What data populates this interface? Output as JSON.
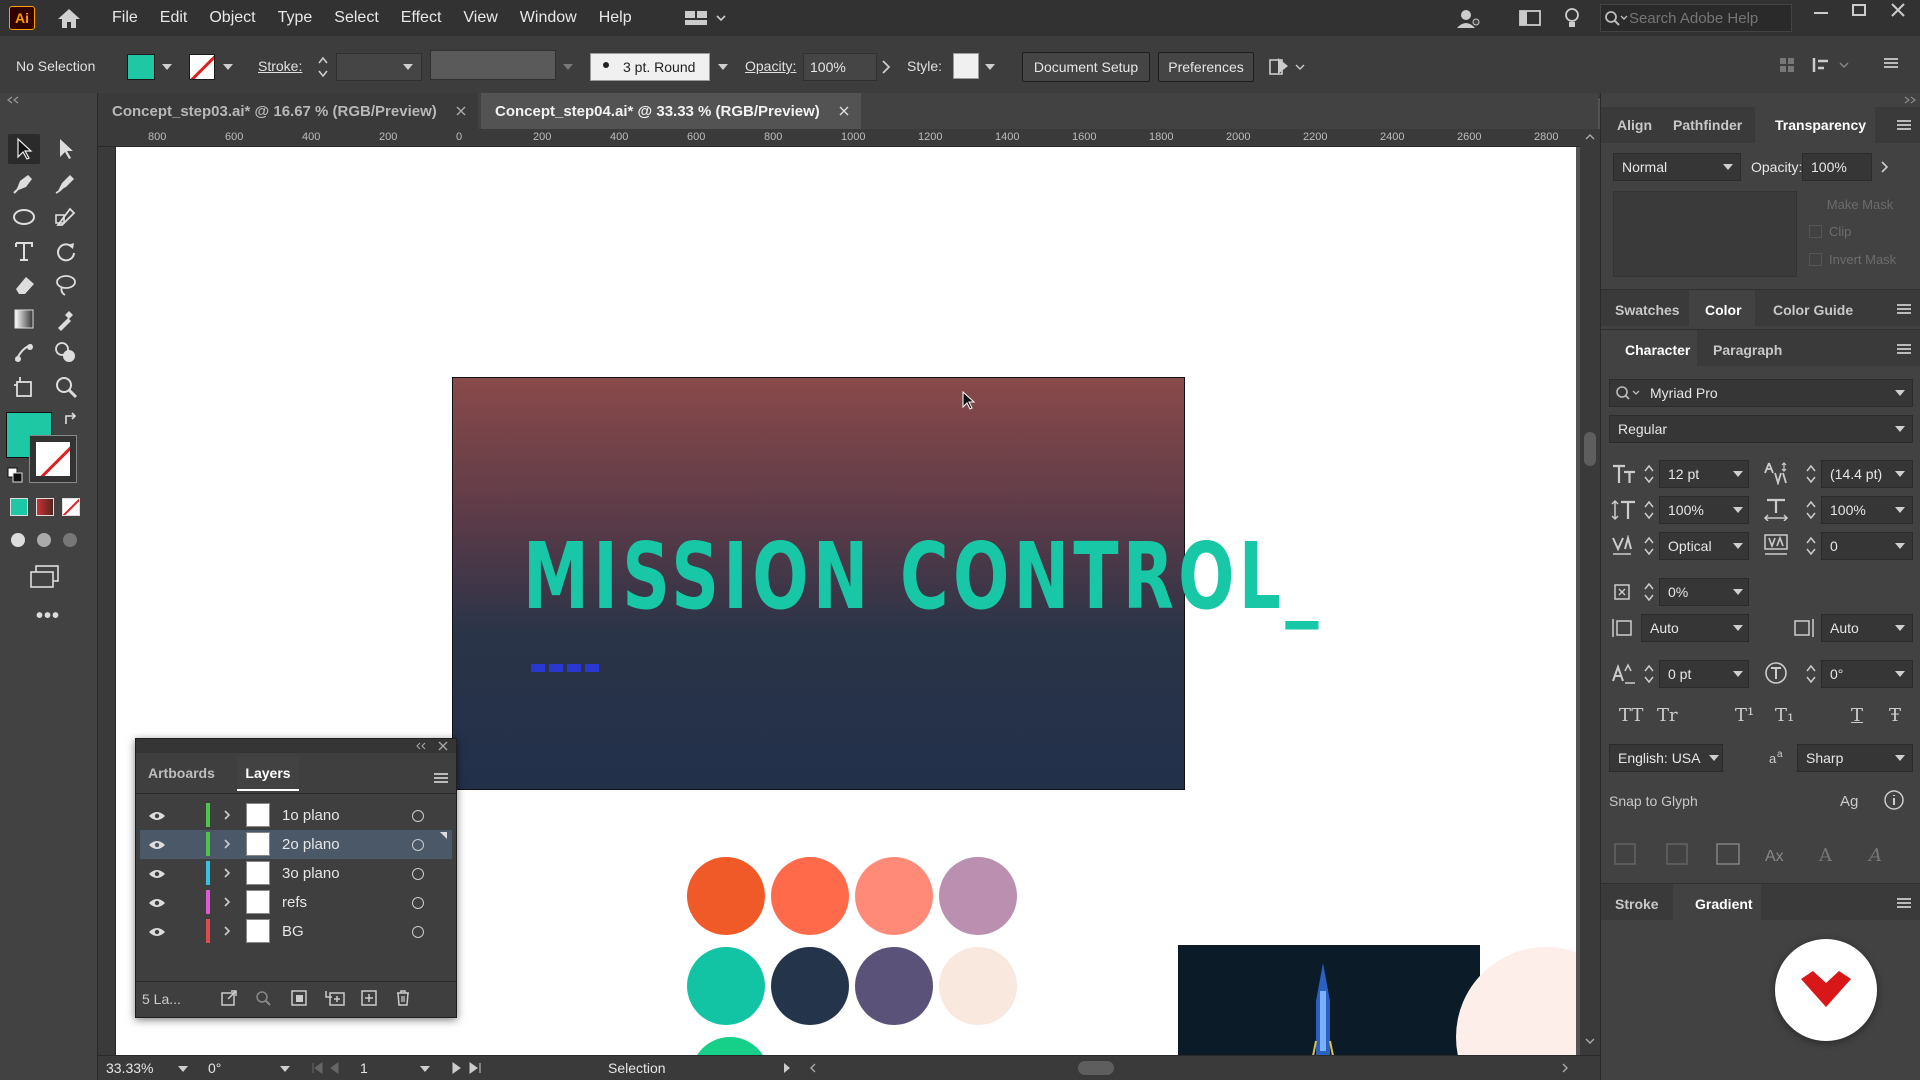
{
  "app": {
    "logo": "Ai"
  },
  "menu": [
    "File",
    "Edit",
    "Object",
    "Type",
    "Select",
    "Effect",
    "View",
    "Window",
    "Help"
  ],
  "search": {
    "placeholder": "Search Adobe Help"
  },
  "control": {
    "selection": "No Selection",
    "stroke_label": "Stroke:",
    "brush": "3 pt. Round",
    "opacity_label": "Opacity:",
    "opacity_value": "100%",
    "style_label": "Style:",
    "doc_setup": "Document Setup",
    "preferences": "Preferences",
    "fill_color": "#1ec8a5"
  },
  "tabs": [
    {
      "label": "Concept_step03.ai* @ 16.67 % (RGB/Preview)"
    },
    {
      "label": "Concept_step04.ai* @ 33.33 % (RGB/Preview)"
    }
  ],
  "ruler": [
    "800",
    "600",
    "400",
    "200",
    "0",
    "200",
    "400",
    "600",
    "800",
    "1000",
    "1200",
    "1400",
    "1600",
    "1800",
    "2000",
    "2200",
    "2400",
    "2600",
    "2800"
  ],
  "artboard": {
    "title": "MISSION CONTROL",
    "cursor": "_",
    "colors": {
      "top": "#8a4a4a",
      "bottom": "#22304a",
      "text": "#17c7a6"
    }
  },
  "swatches": [
    "#f05a28",
    "#ff6a4a",
    "#ff8a78",
    "#bb8fb0",
    "#12c4a4",
    "#24344a",
    "#5a5278",
    "#f8e8de"
  ],
  "layers_panel": {
    "tabs": [
      "Artboards",
      "Layers"
    ],
    "rows": [
      {
        "name": "1o plano",
        "color": "#4ec34e"
      },
      {
        "name": "2o plano",
        "color": "#4ec34e"
      },
      {
        "name": "3o plano",
        "color": "#34c4e0"
      },
      {
        "name": "refs",
        "color": "#e05ad8"
      },
      {
        "name": "BG",
        "color": "#e04a4a"
      }
    ],
    "footer": "5 La..."
  },
  "status": {
    "zoom": "33.33%",
    "rotate": "0°",
    "artboard_num": "1",
    "tool": "Selection"
  },
  "panels": {
    "top_tabs": [
      "Align",
      "Pathfinder",
      "Transparency"
    ],
    "blend": "Normal",
    "opacity_label": "Opacity:",
    "opacity_value": "100%",
    "make_mask": "Make Mask",
    "clip": "Clip",
    "invert": "Invert Mask",
    "color_tabs": [
      "Swatches",
      "Color",
      "Color Guide"
    ],
    "char_tabs": [
      "Character",
      "Paragraph"
    ],
    "font": "Myriad Pro",
    "weight": "Regular",
    "size": "12 pt",
    "leading": "(14.4 pt)",
    "vscale": "100%",
    "hscale": "100%",
    "kerning": "Optical",
    "tracking": "0",
    "tsume": "0%",
    "aki_left": "Auto",
    "aki_right": "Auto",
    "baseline": "0 pt",
    "rotation": "0°",
    "language": "English: USA",
    "aa": "Sharp",
    "snap": "Snap to Glyph",
    "stroke_tabs": [
      "Stroke",
      "Gradient"
    ],
    "caps": [
      "TT",
      "Tr",
      "T¹",
      "T₁",
      "T",
      "Ŧ"
    ]
  }
}
